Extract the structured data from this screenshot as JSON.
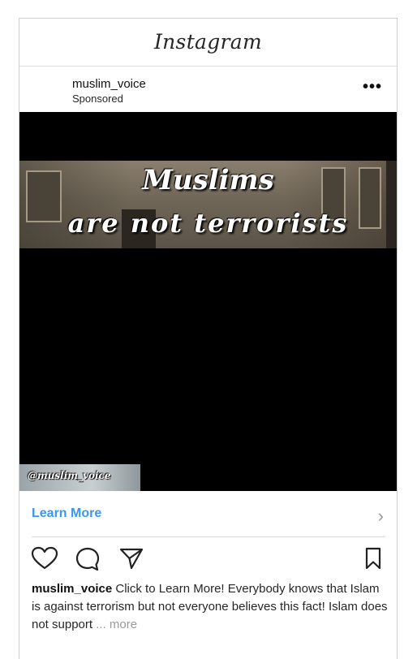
{
  "app": {
    "title": "Instagram"
  },
  "post": {
    "username": "muslim_voice",
    "sponsored_label": "Sponsored",
    "more_options": "•••",
    "media": {
      "headline_line1": "Muslims",
      "headline_line2": "are not terrorists",
      "watermark": "@muslim_voice"
    },
    "cta": {
      "label": "Learn More",
      "chevron": "›"
    },
    "actions": [
      "heart-icon",
      "comment-icon",
      "share-icon",
      "bookmark-icon"
    ],
    "caption": {
      "username": "muslim_voice",
      "text": " Click to Learn More! Everybody knows that Islam is against terrorism but not everyone believes this fact! Islam does not support ",
      "ellipsis": "...",
      "more_label": " more"
    }
  }
}
